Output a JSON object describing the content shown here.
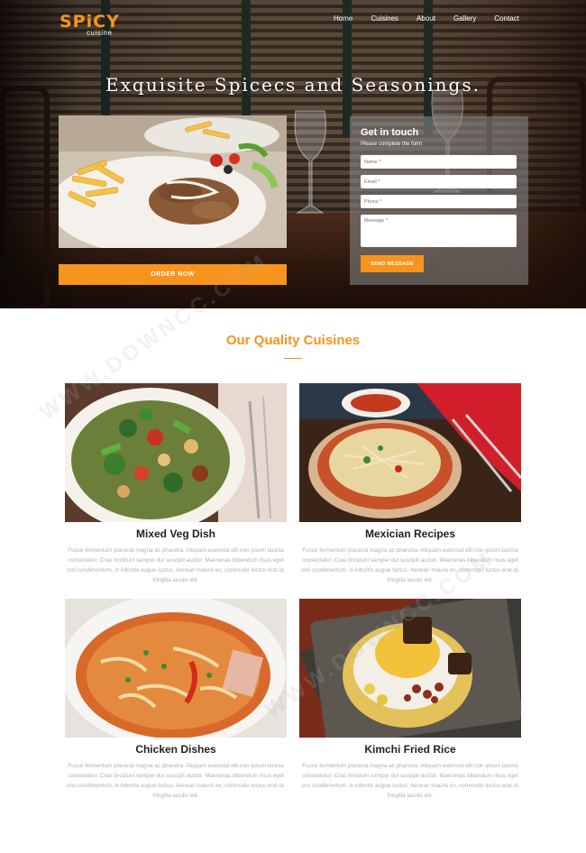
{
  "brand": {
    "logo_main": "SPiCY",
    "logo_sub": "cuisine",
    "accent_color": "#f7941e"
  },
  "nav": {
    "items": [
      "Home",
      "Cuisines",
      "About",
      "Gallery",
      "Contact"
    ]
  },
  "hero": {
    "title": "Exquisite Spicecs and Seasonings.",
    "order_button": "ORDER NOW"
  },
  "contact": {
    "title": "Get in touch",
    "subtitle": "Please complete the form",
    "name_placeholder": "Name *",
    "email_placeholder": "Email *",
    "phone_placeholder": "Phone *",
    "message_placeholder": "Message *",
    "send_button": "SEND MESSAGE"
  },
  "cuisines": {
    "heading": "Our Quality Cuisines",
    "items": [
      {
        "title": "Mixed Veg Dish",
        "desc": "Fusce fermentum placerat magna ac pharetra. Aliquam euismod elit non ipsum lacinia consectetur. Cras tincidunt semper dui suscipit auctor. Maecenas bibendum risus eget orci condimentum, in lobortis augue luctus. Aenean mauris ex, commodo luctus erat id, fringilla iaculis elit."
      },
      {
        "title": "Mexician Recipes",
        "desc": "Fusce fermentum placerat magna ac pharetra. Aliquam euismod elit non ipsum lacinia consectetur. Cras tincidunt semper dui suscipit auctor. Maecenas bibendum risus eget orci condimentum, in lobortis augue luctus. Aenean mauris ex, commodo luctus erat id, fringilla iaculis elit."
      },
      {
        "title": "Chicken Dishes",
        "desc": "Fusce fermentum placerat magna ac pharetra. Aliquam euismod elit non ipsum lacinia consectetur. Cras tincidunt semper dui suscipit auctor. Maecenas bibendum risus eget orci condimentum, in lobortis augue luctus. Aenean mauris ex, commodo luctus erat id, fringilla iaculis elit."
      },
      {
        "title": "Kimchi Fried Rice",
        "desc": "Fusce fermentum placerat magna ac pharetra. Aliquam euismod elit non ipsum lacinia consectetur. Cras tincidunt semper dui suscipit auctor. Maecenas bibendum risus eget orci condimentum, in lobortis augue luctus. Aenean mauris ex, commodo luctus erat id, fringilla iaculis elit."
      }
    ]
  },
  "watermark": {
    "text": "WWW.DOWNCC.COM"
  }
}
